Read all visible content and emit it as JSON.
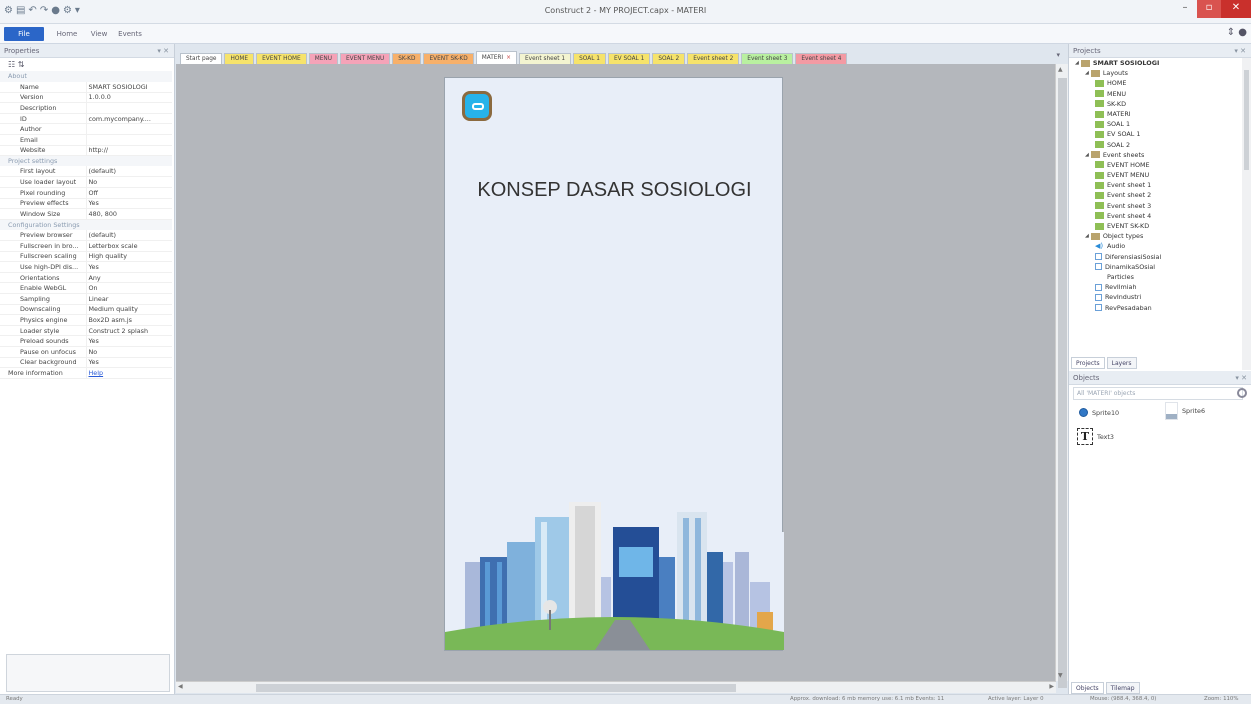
{
  "window": {
    "title": "Construct 2 - MY PROJECT.capx - MATERI",
    "qat": [
      "⚙",
      "▤",
      "↶",
      "↷",
      "●",
      "⚙",
      "▾"
    ]
  },
  "ribbon": {
    "tabs": [
      "File",
      "Home",
      "View",
      "Events"
    ]
  },
  "properties": {
    "header": "Properties",
    "sections": [
      {
        "title": "About",
        "rows": [
          {
            "name": "Name",
            "value": "SMART SOSIOLOGI"
          },
          {
            "name": "Version",
            "value": "1.0.0.0"
          },
          {
            "name": "Description",
            "value": ""
          },
          {
            "name": "ID",
            "value": "com.mycompany...."
          },
          {
            "name": "Author",
            "value": ""
          },
          {
            "name": "Email",
            "value": ""
          },
          {
            "name": "Website",
            "value": "http://"
          }
        ]
      },
      {
        "title": "Project settings",
        "rows": [
          {
            "name": "First layout",
            "value": "(default)"
          },
          {
            "name": "Use loader layout",
            "value": "No"
          },
          {
            "name": "Pixel rounding",
            "value": "Off"
          },
          {
            "name": "Preview effects",
            "value": "Yes"
          },
          {
            "name": "Window Size",
            "value": "480, 800"
          }
        ]
      },
      {
        "title": "Configuration Settings",
        "rows": [
          {
            "name": "Preview browser",
            "value": "(default)"
          },
          {
            "name": "Fullscreen in bro...",
            "value": "Letterbox scale"
          },
          {
            "name": "Fullscreen scaling",
            "value": "High quality"
          },
          {
            "name": "Use high-DPI dis...",
            "value": "Yes"
          },
          {
            "name": "Orientations",
            "value": "Any"
          },
          {
            "name": "Enable WebGL",
            "value": "On"
          },
          {
            "name": "Sampling",
            "value": "Linear"
          },
          {
            "name": "Downscaling",
            "value": "Medium quality"
          },
          {
            "name": "Physics engine",
            "value": "Box2D asm.js"
          },
          {
            "name": "Loader style",
            "value": "Construct 2 splash"
          },
          {
            "name": "Preload sounds",
            "value": "Yes"
          },
          {
            "name": "Pause on unfocus",
            "value": "No"
          },
          {
            "name": "Clear background",
            "value": "Yes"
          }
        ]
      }
    ],
    "more_info": {
      "name": "More information",
      "value": "Help"
    }
  },
  "doc_tabs": [
    {
      "label": "Start page",
      "color": "#ffffff"
    },
    {
      "label": "HOME",
      "color": "#f6e36b"
    },
    {
      "label": "EVENT HOME",
      "color": "#f6e36b"
    },
    {
      "label": "MENU",
      "color": "#f5a3b8"
    },
    {
      "label": "EVENT MENU",
      "color": "#f5a3b8"
    },
    {
      "label": "SK-KD",
      "color": "#f7b06a"
    },
    {
      "label": "EVENT SK-KD",
      "color": "#f7b06a"
    },
    {
      "label": "MATERI",
      "color": "#ffffff",
      "active": true
    },
    {
      "label": "Event sheet 1",
      "color": "#f3f4d0"
    },
    {
      "label": "SOAL 1",
      "color": "#f6e36b"
    },
    {
      "label": "EV SOAL 1",
      "color": "#f6e36b"
    },
    {
      "label": "SOAL 2",
      "color": "#f6e36b"
    },
    {
      "label": "Event sheet 2",
      "color": "#f6e36b"
    },
    {
      "label": "Event sheet 3",
      "color": "#b9f0a0"
    },
    {
      "label": "Event sheet 4",
      "color": "#f39aa3"
    }
  ],
  "canvas": {
    "title": "KONSEP DASAR SOSIOLOGI"
  },
  "projects": {
    "header": "Projects",
    "tree": [
      {
        "label": "SMART SOSIOLOGI",
        "level": 0,
        "icon": "folder",
        "root": true
      },
      {
        "label": "Layouts",
        "level": 1,
        "icon": "folder"
      },
      {
        "label": "HOME",
        "level": 2,
        "icon": "layout"
      },
      {
        "label": "MENU",
        "level": 2,
        "icon": "layout"
      },
      {
        "label": "SK-KD",
        "level": 2,
        "icon": "layout"
      },
      {
        "label": "MATERI",
        "level": 2,
        "icon": "layout"
      },
      {
        "label": "SOAL 1",
        "level": 2,
        "icon": "layout"
      },
      {
        "label": "EV SOAL 1",
        "level": 2,
        "icon": "layout"
      },
      {
        "label": "SOAL 2",
        "level": 2,
        "icon": "layout"
      },
      {
        "label": "Event sheets",
        "level": 1,
        "icon": "folder"
      },
      {
        "label": "EVENT HOME",
        "level": 2,
        "icon": "layout"
      },
      {
        "label": "EVENT MENU",
        "level": 2,
        "icon": "layout"
      },
      {
        "label": "Event sheet 1",
        "level": 2,
        "icon": "layout"
      },
      {
        "label": "Event sheet 2",
        "level": 2,
        "icon": "layout"
      },
      {
        "label": "Event sheet 3",
        "level": 2,
        "icon": "layout"
      },
      {
        "label": "Event sheet 4",
        "level": 2,
        "icon": "layout"
      },
      {
        "label": "EVENT SK-KD",
        "level": 2,
        "icon": "layout"
      },
      {
        "label": "Object types",
        "level": 1,
        "icon": "folder"
      },
      {
        "label": "Audio",
        "level": 2,
        "icon": "audio"
      },
      {
        "label": "DiferensiasiSosial",
        "level": 2,
        "icon": "sprite"
      },
      {
        "label": "DinamikaSOsial",
        "level": 2,
        "icon": "sprite"
      },
      {
        "label": "Particles",
        "level": 2,
        "icon": "blank"
      },
      {
        "label": "RevIlmiah",
        "level": 2,
        "icon": "sprite"
      },
      {
        "label": "RevIndustri",
        "level": 2,
        "icon": "sprite"
      },
      {
        "label": "RevPesadaban",
        "level": 2,
        "icon": "sprite"
      }
    ],
    "tabs": [
      "Projects",
      "Layers"
    ]
  },
  "objects": {
    "header": "Objects",
    "filter": "All 'MATERI' objects",
    "items": [
      {
        "label": "Sprite10",
        "icon": "sprite-ball"
      },
      {
        "label": "Sprite6",
        "icon": "sprite-image"
      },
      {
        "label": "Text3",
        "icon": "text"
      }
    ],
    "tabs": [
      "Objects",
      "Tilemap"
    ]
  },
  "status": {
    "left": "Ready",
    "stats": "Approx. download: 6 mb  memory use: 6.1 mb  Events: 11",
    "layer": "Active layer: Layer 0",
    "mouse": "Mouse: (988.4, 368.4, 0)",
    "zoom": "Zoom: 110%"
  }
}
